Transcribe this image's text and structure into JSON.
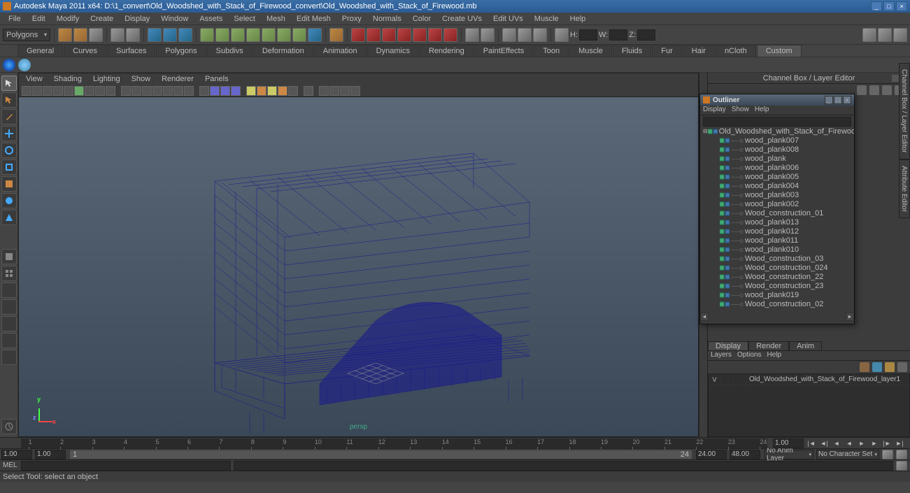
{
  "title": "Autodesk Maya 2011 x64: D:\\1_convert\\Old_Woodshed_with_Stack_of_Firewood_convert\\Old_Woodshed_with_Stack_of_Firewood.mb",
  "menus": [
    "File",
    "Edit",
    "Modify",
    "Create",
    "Display",
    "Window",
    "Assets",
    "Select",
    "Mesh",
    "Edit Mesh",
    "Proxy",
    "Normals",
    "Color",
    "Create UVs",
    "Edit UVs",
    "Muscle",
    "Help"
  ],
  "shelf_selector": "Polygons",
  "shelf_inputs": {
    "h": "H:",
    "w": "W:",
    "z": "Z:"
  },
  "tabs": [
    "General",
    "Curves",
    "Surfaces",
    "Polygons",
    "Subdivs",
    "Deformation",
    "Animation",
    "Dynamics",
    "Rendering",
    "PaintEffects",
    "Toon",
    "Muscle",
    "Fluids",
    "Fur",
    "Hair",
    "nCloth",
    "Custom"
  ],
  "active_tab": "Custom",
  "vp_menus": [
    "View",
    "Shading",
    "Lighting",
    "Show",
    "Renderer",
    "Panels"
  ],
  "persp_label": "persp",
  "rp_title": "Channel Box / Layer Editor",
  "vtabs": [
    "Channel Box / Layer Editor",
    "Attribute Editor"
  ],
  "outliner": {
    "title": "Outliner",
    "menus": [
      "Display",
      "Show",
      "Help"
    ],
    "root": "Old_Woodshed_with_Stack_of_Firewood",
    "items": [
      "wood_plank007",
      "wood_plank008",
      "wood_plank",
      "wood_plank006",
      "wood_plank005",
      "wood_plank004",
      "wood_plank003",
      "wood_plank002",
      "Wood_construction_01",
      "wood_plank013",
      "wood_plank012",
      "wood_plank011",
      "wood_plank010",
      "Wood_construction_03",
      "Wood_construction_024",
      "Wood_construction_22",
      "Wood_construction_23",
      "wood_plank019",
      "Wood_construction_02"
    ]
  },
  "layer_tabs": [
    "Display",
    "Render",
    "Anim"
  ],
  "layer_active": "Display",
  "layer_menus": [
    "Layers",
    "Options",
    "Help"
  ],
  "layer_row": {
    "vis": "V",
    "name": "Old_Woodshed_with_Stack_of_Firewood_layer1"
  },
  "timeline": {
    "ticks": [
      "1",
      "2",
      "3",
      "4",
      "5",
      "6",
      "7",
      "8",
      "9",
      "10",
      "11",
      "12",
      "13",
      "14",
      "15",
      "16",
      "17",
      "18",
      "19",
      "20",
      "21",
      "22",
      "23",
      "24"
    ],
    "current": "1.00"
  },
  "range": {
    "start": "1.00",
    "in": "1.00",
    "handle_start": "1",
    "handle_end": "24",
    "out": "24.00",
    "end": "48.00"
  },
  "anim_layer": "No Anim Layer",
  "char_set": "No Character Set",
  "cmd_label": "MEL",
  "help_text": "Select Tool: select an object"
}
